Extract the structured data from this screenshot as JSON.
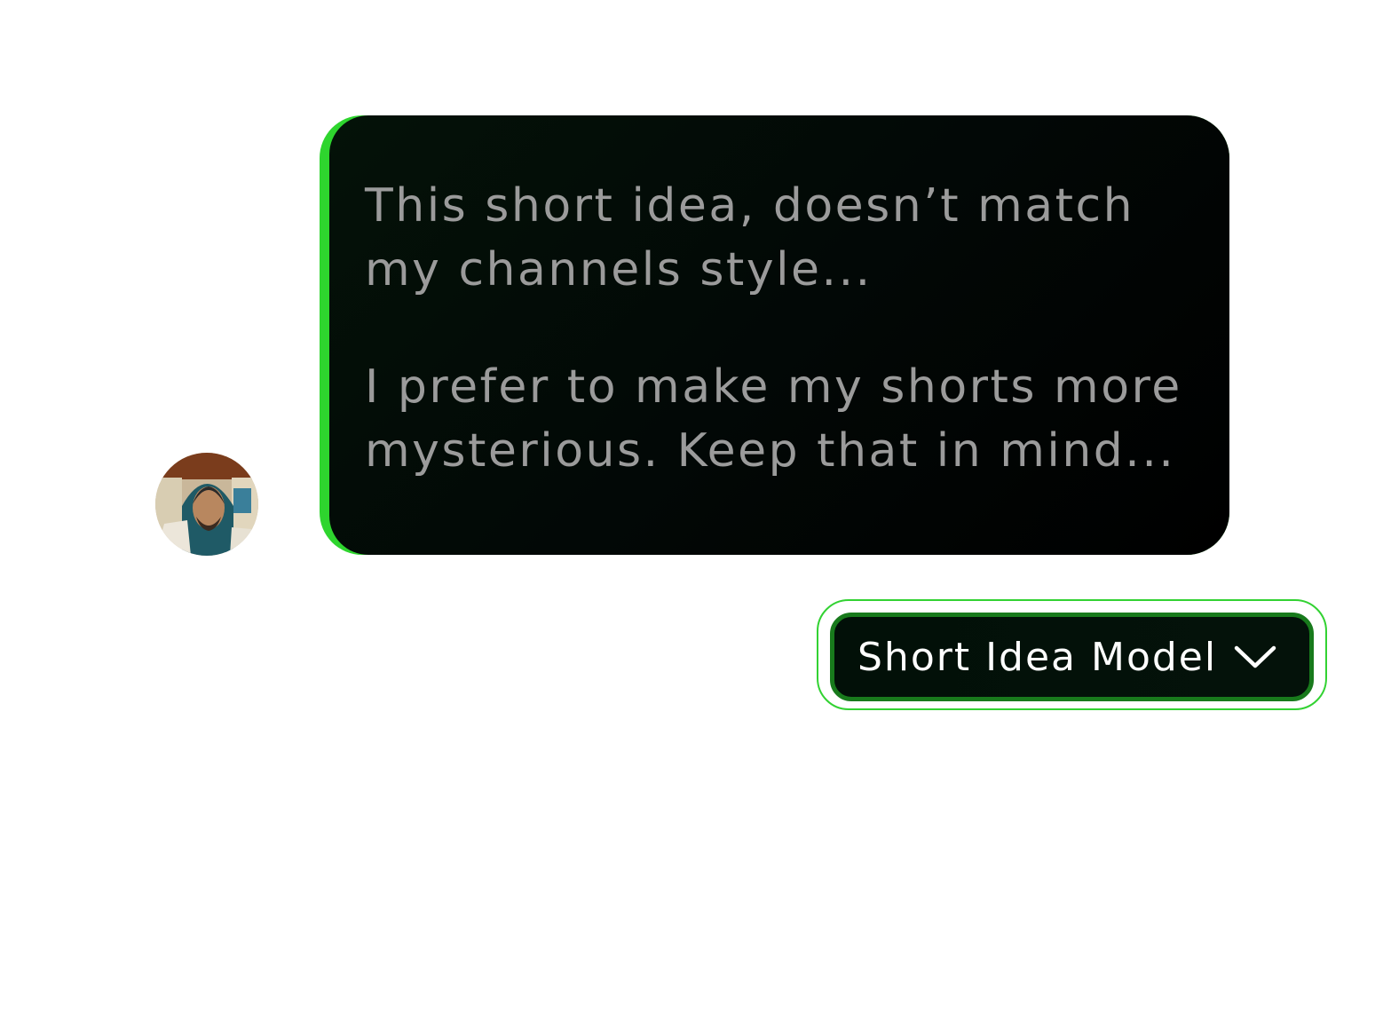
{
  "message": {
    "paragraphs": [
      {
        "lines": [
          "This short idea, doesn’t match",
          "my channels style..."
        ]
      },
      {
        "lines": [
          "I prefer to make my shorts more",
          "mysterious. Keep that in mind..."
        ]
      }
    ]
  },
  "avatar": {
    "icon": "user-avatar-photo"
  },
  "model_selector": {
    "label": "Short Idea Model",
    "icon": "chevron-down-icon"
  },
  "colors": {
    "accent": "#2ed52e",
    "bubble_bg": "#020806",
    "bubble_text": "#9b9b9b",
    "selector_border": "#187a1c",
    "selector_text": "#ffffff"
  }
}
